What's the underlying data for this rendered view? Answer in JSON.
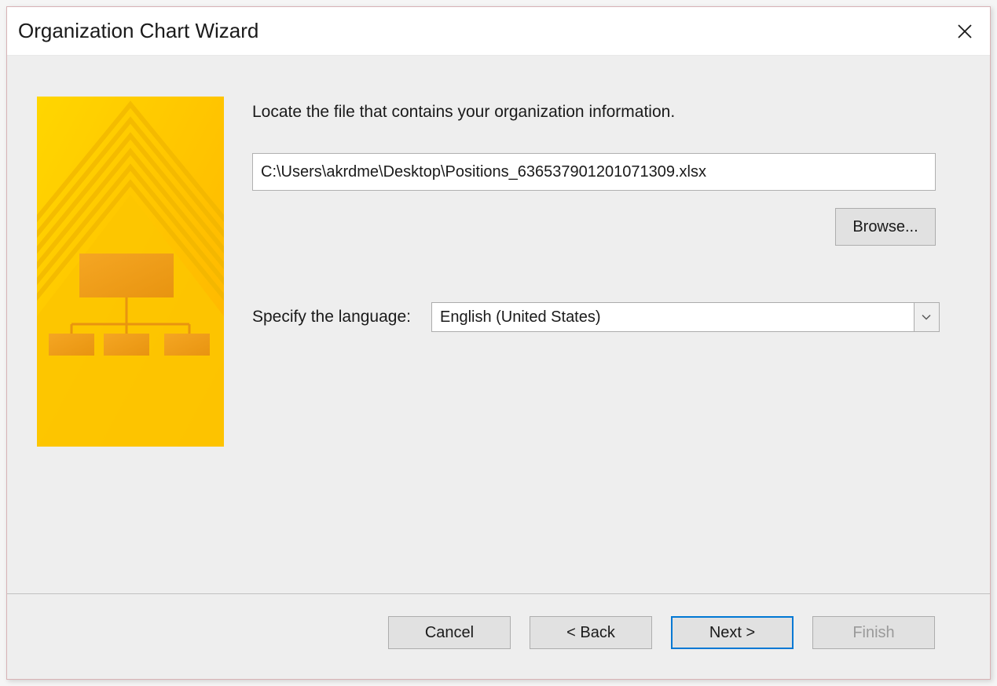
{
  "dialog": {
    "title": "Organization Chart Wizard"
  },
  "form": {
    "instruction": "Locate the file that contains your organization information.",
    "file_path": "C:\\Users\\akrdme\\Desktop\\Positions_636537901201071309.xlsx",
    "browse_label": "Browse...",
    "language_label": "Specify the language:",
    "language_value": "English (United States)"
  },
  "footer": {
    "cancel": "Cancel",
    "back": "< Back",
    "next": "Next >",
    "finish": "Finish"
  }
}
